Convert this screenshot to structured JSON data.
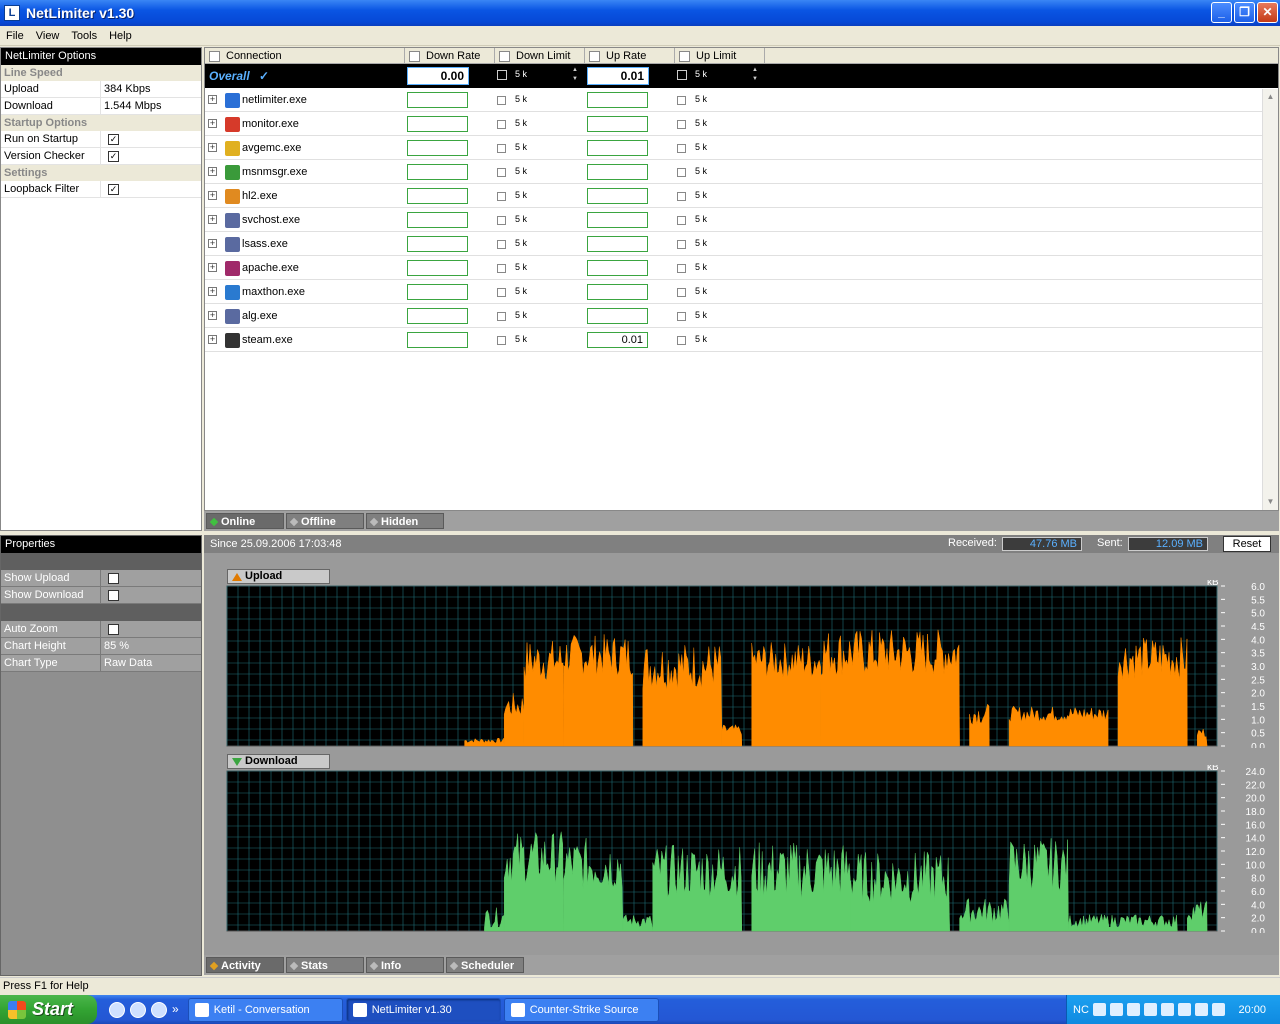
{
  "window": {
    "title": "NetLimiter v1.30"
  },
  "menu": [
    "File",
    "View",
    "Tools",
    "Help"
  ],
  "options": {
    "header": "NetLimiter Options",
    "line_speed_label": "Line Speed",
    "upload_label": "Upload",
    "upload_value": "384 Kbps",
    "download_label": "Download",
    "download_value": "1.544 Mbps",
    "startup_label": "Startup Options",
    "run_on_startup_label": "Run on Startup",
    "version_checker_label": "Version Checker",
    "settings_label": "Settings",
    "loopback_label": "Loopback Filter",
    "check_mark": "✓"
  },
  "grid": {
    "columns": [
      "Connection",
      "Down Rate",
      "Down Limit",
      "Up Rate",
      "Up Limit"
    ],
    "overall": {
      "label": "Overall",
      "check": "✓",
      "down_rate": "0.00",
      "down_limit": "5 k",
      "up_rate": "0.01",
      "up_limit": "5 k",
      "spin_up": "▲",
      "spin_down": "▼"
    },
    "expand_glyph": "+",
    "rows": [
      {
        "name": "netlimiter.exe",
        "down_rate": "",
        "down_limit": "5 k",
        "up_rate": "",
        "up_limit": "5 k",
        "color": "#2a6fd6"
      },
      {
        "name": "monitor.exe",
        "down_rate": "",
        "down_limit": "5 k",
        "up_rate": "",
        "up_limit": "5 k",
        "color": "#d63a2a"
      },
      {
        "name": "avgemc.exe",
        "down_rate": "",
        "down_limit": "5 k",
        "up_rate": "",
        "up_limit": "5 k",
        "color": "#e0b020"
      },
      {
        "name": "msnmsgr.exe",
        "down_rate": "",
        "down_limit": "5 k",
        "up_rate": "",
        "up_limit": "5 k",
        "color": "#3a9a3a"
      },
      {
        "name": "hl2.exe",
        "down_rate": "",
        "down_limit": "5 k",
        "up_rate": "",
        "up_limit": "5 k",
        "color": "#e08a20"
      },
      {
        "name": "svchost.exe",
        "down_rate": "",
        "down_limit": "5 k",
        "up_rate": "",
        "up_limit": "5 k",
        "color": "#5a6aa0"
      },
      {
        "name": "lsass.exe",
        "down_rate": "",
        "down_limit": "5 k",
        "up_rate": "",
        "up_limit": "5 k",
        "color": "#5a6aa0"
      },
      {
        "name": "apache.exe",
        "down_rate": "",
        "down_limit": "5 k",
        "up_rate": "",
        "up_limit": "5 k",
        "color": "#a02a6a"
      },
      {
        "name": "maxthon.exe",
        "down_rate": "",
        "down_limit": "5 k",
        "up_rate": "",
        "up_limit": "5 k",
        "color": "#2a7ad0"
      },
      {
        "name": "alg.exe",
        "down_rate": "",
        "down_limit": "5 k",
        "up_rate": "",
        "up_limit": "5 k",
        "color": "#5a6aa0"
      },
      {
        "name": "steam.exe",
        "down_rate": "",
        "down_limit": "5 k",
        "up_rate": "0.01",
        "up_limit": "5 k",
        "color": "#333333"
      }
    ],
    "scroll_up": "▲",
    "scroll_down": "▼"
  },
  "top_tabs": [
    "Online",
    "Offline",
    "Hidden"
  ],
  "properties": {
    "header": "Properties",
    "show_upload_label": "Show Upload",
    "show_download_label": "Show Download",
    "auto_zoom_label": "Auto Zoom",
    "chart_height_label": "Chart Height",
    "chart_height_value": "85 %",
    "chart_type_label": "Chart Type",
    "chart_type_value": "Raw Data",
    "check_mark": "✓"
  },
  "activity": {
    "since": "Since 25.09.2006 17:03:48",
    "received_label": "Received:",
    "received_value": "47.76 MB",
    "sent_label": "Sent:",
    "sent_value": "12.09 MB",
    "reset_label": "Reset"
  },
  "chart_data": [
    {
      "type": "area",
      "title": "Upload",
      "unit": "kB",
      "color": "#ff8c00",
      "ylim": [
        0,
        6
      ],
      "yticks": [
        "0.0",
        "0.5",
        "1.0",
        "1.5",
        "2.0",
        "2.5",
        "3.0",
        "3.5",
        "4.0",
        "4.5",
        "5.0",
        "5.5",
        "6.0"
      ],
      "segments": [
        {
          "x": [
            0.24,
            0.28
          ],
          "y": 0.2,
          "noise": 0.1
        },
        {
          "x": [
            0.28,
            0.3
          ],
          "y": 1.5,
          "noise": 0.5
        },
        {
          "x": [
            0.3,
            0.34
          ],
          "y": 3.2,
          "noise": 0.8
        },
        {
          "x": [
            0.34,
            0.41
          ],
          "y": 3.4,
          "noise": 0.8
        },
        {
          "x": [
            0.42,
            0.5
          ],
          "y": 3.0,
          "noise": 0.9
        },
        {
          "x": [
            0.5,
            0.52
          ],
          "y": 0.6,
          "noise": 0.2
        },
        {
          "x": [
            0.53,
            0.6
          ],
          "y": 3.2,
          "noise": 0.7
        },
        {
          "x": [
            0.6,
            0.74
          ],
          "y": 3.5,
          "noise": 0.9
        },
        {
          "x": [
            0.75,
            0.77
          ],
          "y": 1.2,
          "noise": 0.4
        },
        {
          "x": [
            0.79,
            0.89
          ],
          "y": 1.2,
          "noise": 0.3
        },
        {
          "x": [
            0.9,
            0.97
          ],
          "y": 3.3,
          "noise": 0.8
        },
        {
          "x": [
            0.98,
            0.99
          ],
          "y": 0.5,
          "noise": 0.2
        }
      ]
    },
    {
      "type": "area",
      "title": "Download",
      "unit": "kB",
      "color": "#5fce6b",
      "ylim": [
        0,
        24
      ],
      "yticks": [
        "0.0",
        "2.0",
        "4.0",
        "6.0",
        "8.0",
        "10.0",
        "12.0",
        "14.0",
        "16.0",
        "18.0",
        "20.0",
        "22.0",
        "24.0"
      ],
      "segments": [
        {
          "x": [
            0.26,
            0.28
          ],
          "y": 2.0,
          "noise": 1.5
        },
        {
          "x": [
            0.28,
            0.34
          ],
          "y": 11.0,
          "noise": 4.0
        },
        {
          "x": [
            0.34,
            0.4
          ],
          "y": 10.0,
          "noise": 4.0
        },
        {
          "x": [
            0.4,
            0.43
          ],
          "y": 1.5,
          "noise": 1.0
        },
        {
          "x": [
            0.43,
            0.52
          ],
          "y": 9.0,
          "noise": 4.0
        },
        {
          "x": [
            0.53,
            0.63
          ],
          "y": 9.0,
          "noise": 4.5
        },
        {
          "x": [
            0.63,
            0.73
          ],
          "y": 8.0,
          "noise": 4.0
        },
        {
          "x": [
            0.74,
            0.79
          ],
          "y": 3.0,
          "noise": 2.0
        },
        {
          "x": [
            0.79,
            0.85
          ],
          "y": 10.0,
          "noise": 4.0
        },
        {
          "x": [
            0.85,
            0.96
          ],
          "y": 1.5,
          "noise": 1.0
        },
        {
          "x": [
            0.97,
            0.99
          ],
          "y": 3.0,
          "noise": 1.5
        }
      ]
    }
  ],
  "bottom_tabs": [
    "Activity",
    "Stats",
    "Info",
    "Scheduler"
  ],
  "status": "Press F1 for Help",
  "taskbar": {
    "start": "Start",
    "more": "»",
    "buttons": [
      "Ketil - Conversation",
      "NetLimiter v1.30",
      "Counter-Strike Source"
    ],
    "tray_text": "NC",
    "clock": "20:00"
  }
}
